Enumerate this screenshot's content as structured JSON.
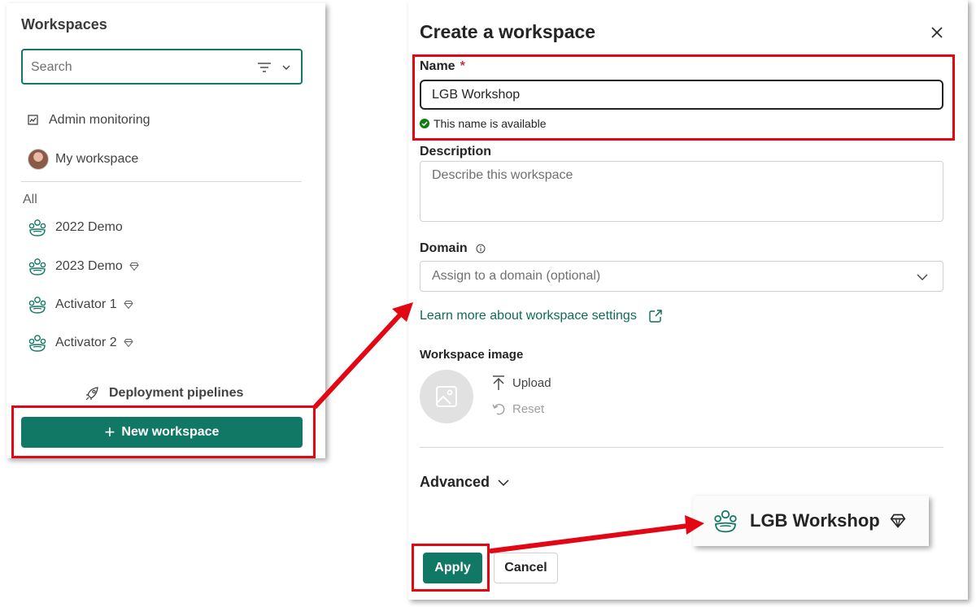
{
  "left": {
    "title": "Workspaces",
    "search_placeholder": "Search",
    "admin_monitoring": "Admin monitoring",
    "my_workspace": "My workspace",
    "section_all": "All",
    "workspaces": [
      {
        "label": "2022 Demo",
        "premium": false
      },
      {
        "label": "2023 Demo",
        "premium": true
      },
      {
        "label": "Activator 1",
        "premium": true
      },
      {
        "label": "Activator 2",
        "premium": true
      }
    ],
    "deployment_pipelines": "Deployment pipelines",
    "new_workspace": "New workspace"
  },
  "panel": {
    "title": "Create a workspace",
    "name_label": "Name",
    "required_mark": "*",
    "name_value": "LGB Workshop",
    "name_available": "This name is available",
    "description_label": "Description",
    "description_placeholder": "Describe this workspace",
    "domain_label": "Domain",
    "domain_placeholder": "Assign to a domain (optional)",
    "learn_more": "Learn more about workspace settings",
    "image_label": "Workspace image",
    "upload": "Upload",
    "reset": "Reset",
    "advanced": "Advanced",
    "apply": "Apply",
    "cancel": "Cancel"
  },
  "callout": {
    "label": "LGB Workshop"
  },
  "colors": {
    "accent": "#117865",
    "highlight": "#e30613",
    "available": "#107c10"
  },
  "icons": [
    "filter-icon",
    "chevron-down-icon",
    "admin-monitoring-icon",
    "avatar",
    "workspace-icon",
    "premium-diamond-icon",
    "rocket-icon",
    "plus-icon",
    "close-icon",
    "check-circle-icon",
    "info-icon",
    "external-link-icon",
    "image-icon",
    "upload-icon",
    "reset-icon"
  ]
}
